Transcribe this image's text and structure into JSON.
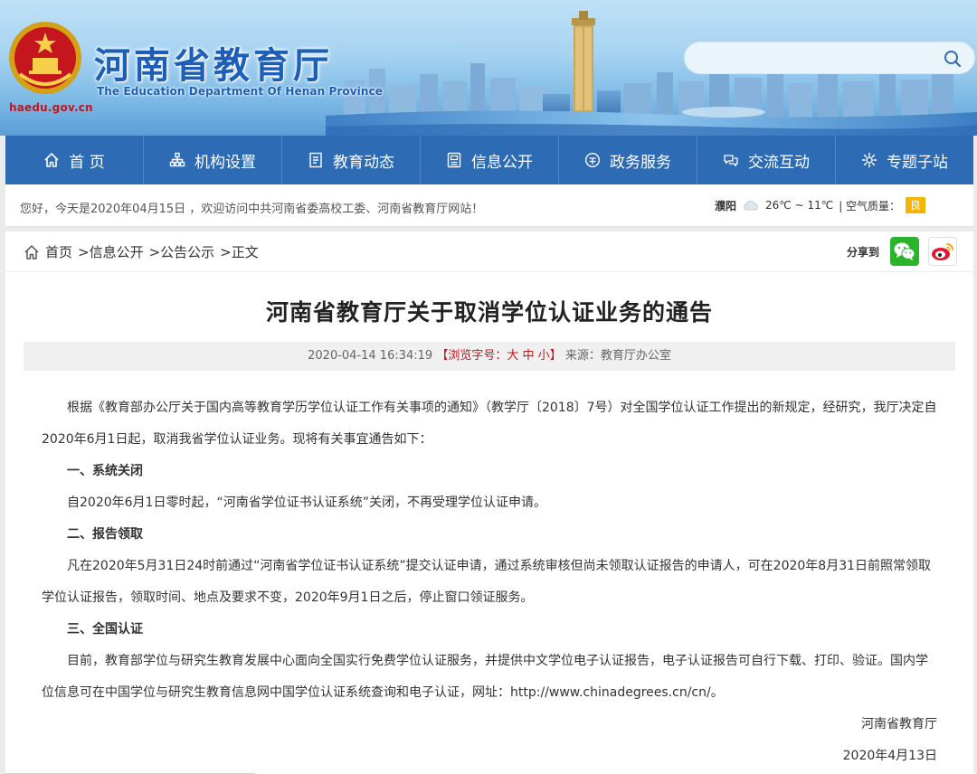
{
  "header": {
    "title": "河南省教育厅",
    "subtitle": "The Education Department Of Henan Province",
    "domain": "haedu.gov.cn",
    "search_placeholder": ""
  },
  "nav": {
    "items": [
      {
        "label": "首 页",
        "icon": "home-icon"
      },
      {
        "label": "机构设置",
        "icon": "org-icon"
      },
      {
        "label": "教育动态",
        "icon": "news-icon"
      },
      {
        "label": "信息公开",
        "icon": "document-icon"
      },
      {
        "label": "政务服务",
        "icon": "service-icon"
      },
      {
        "label": "交流互动",
        "icon": "interact-icon"
      },
      {
        "label": "专题子站",
        "icon": "gear-icon"
      }
    ]
  },
  "welcome": {
    "text": "您好，今天是2020年04月15日 ，欢迎访问中共河南省委高校工委、河南省教育厅网站！",
    "city": "濮阳",
    "temperature": "26℃ ~ 11℃",
    "air_label": "| 空气质量：",
    "air_quality": "良"
  },
  "breadcrumb": {
    "home": "首页",
    "items": [
      ">信息公开",
      ">公告公示",
      ">正文"
    ]
  },
  "share": {
    "label": "分享到"
  },
  "article": {
    "title": "河南省教育厅关于取消学位认证业务的通告",
    "datetime": "2020-04-14 16:34:19",
    "fontsize_label_open": "【浏览字号：",
    "fontsize_large": "大",
    "fontsize_medium": "中",
    "fontsize_small": "小",
    "fontsize_label_close": "】",
    "source": "来源：教育厅办公室",
    "paragraphs": {
      "intro": "根据《教育部办公厅关于国内高等教育学历学位认证工作有关事项的通知》（教学厅〔2018〕7号）对全国学位认证工作提出的新规定，经研究，我厅决定自2020年6月1日起，取消我省学位认证业务。现将有关事宜通告如下：",
      "h1": "一、系统关闭",
      "p1": "自2020年6月1日零时起，“河南省学位证书认证系统”关闭，不再受理学位认证申请。",
      "h2": "二、报告领取",
      "p2": "凡在2020年5月31日24时前通过“河南省学位证书认证系统”提交认证申请，通过系统审核但尚未领取认证报告的申请人，可在2020年8月31日前照常领取学位认证报告，领取时间、地点及要求不变，2020年9月1日之后，停止窗口领证服务。",
      "h3": "三、全国认证",
      "p3": "目前，教育部学位与研究生教育发展中心面向全国实行免费学位认证服务，并提供中文学位电子认证报告，电子认证报告可自行下载、打印、验证。国内学位信息可在中国学位与研究生教育信息网中国学位认证系统查询和电子认证，网址：http://www.chinadegrees.cn/cn/。"
    },
    "signature": "河南省教育厅",
    "date": "2020年4月13日"
  },
  "colors": {
    "nav_bg": "#2d6bb5",
    "title_blue": "#1d5fb8",
    "accent_red": "#c4161c",
    "aqi_yellow": "#f4b400",
    "wechat_green": "#2bb42b"
  }
}
